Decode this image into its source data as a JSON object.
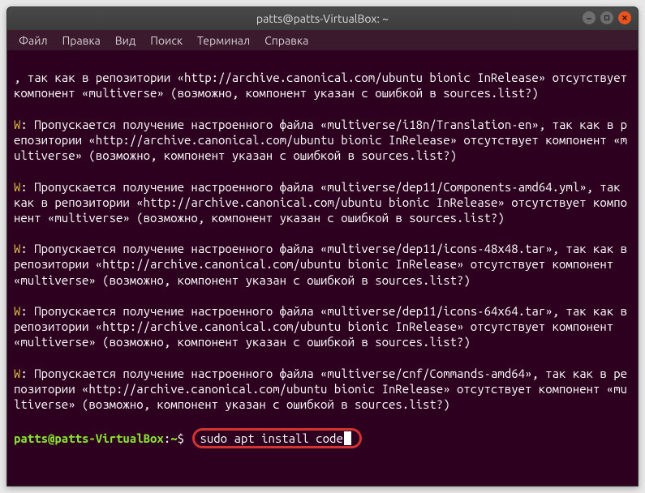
{
  "titlebar": {
    "title": "patts@patts-VirtualBox: ~"
  },
  "menubar": {
    "items": [
      "Файл",
      "Правка",
      "Вид",
      "Поиск",
      "Терминал",
      "Справка"
    ]
  },
  "terminal": {
    "lines": [
      ", так как в репозитории «http://archive.canonical.com/ubuntu bionic InRelease» отсутствует компонент «multiverse» (возможно, компонент указан с ошибкой в sources.list?)",
      "W: Пропускается получение настроенного файла «multiverse/i18n/Translation-en», так как в репозитории «http://archive.canonical.com/ubuntu bionic InRelease» отсутствует компонент «multiverse» (возможно, компонент указан с ошибкой в sources.list?)",
      "W: Пропускается получение настроенного файла «multiverse/dep11/Components-amd64.yml», так как в репозитории «http://archive.canonical.com/ubuntu bionic InRelease» отсутствует компонент «multiverse» (возможно, компонент указан с ошибкой в sources.list?)",
      "W: Пропускается получение настроенного файла «multiverse/dep11/icons-48x48.tar», так как в репозитории «http://archive.canonical.com/ubuntu bionic InRelease» отсутствует компонент «multiverse» (возможно, компонент указан с ошибкой в sources.list?)",
      "W: Пропускается получение настроенного файла «multiverse/dep11/icons-64x64.tar», так как в репозитории «http://archive.canonical.com/ubuntu bionic InRelease» отсутствует компонент «multiverse» (возможно, компонент указан с ошибкой в sources.list?)",
      "W: Пропускается получение настроенного файла «multiverse/cnf/Commands-amd64», так как в репозитории «http://archive.canonical.com/ubuntu bionic InRelease» отсутствует компонент «multiverse» (возможно, компонент указан с ошибкой в sources.list?)"
    ],
    "prompt": {
      "user_host": "patts@patts-VirtualBox",
      "sep": ":",
      "path": "~",
      "dollar": "$ ",
      "command": "sudo apt install code"
    }
  },
  "colors": {
    "warn_char": "W",
    "line_sep": ": "
  }
}
